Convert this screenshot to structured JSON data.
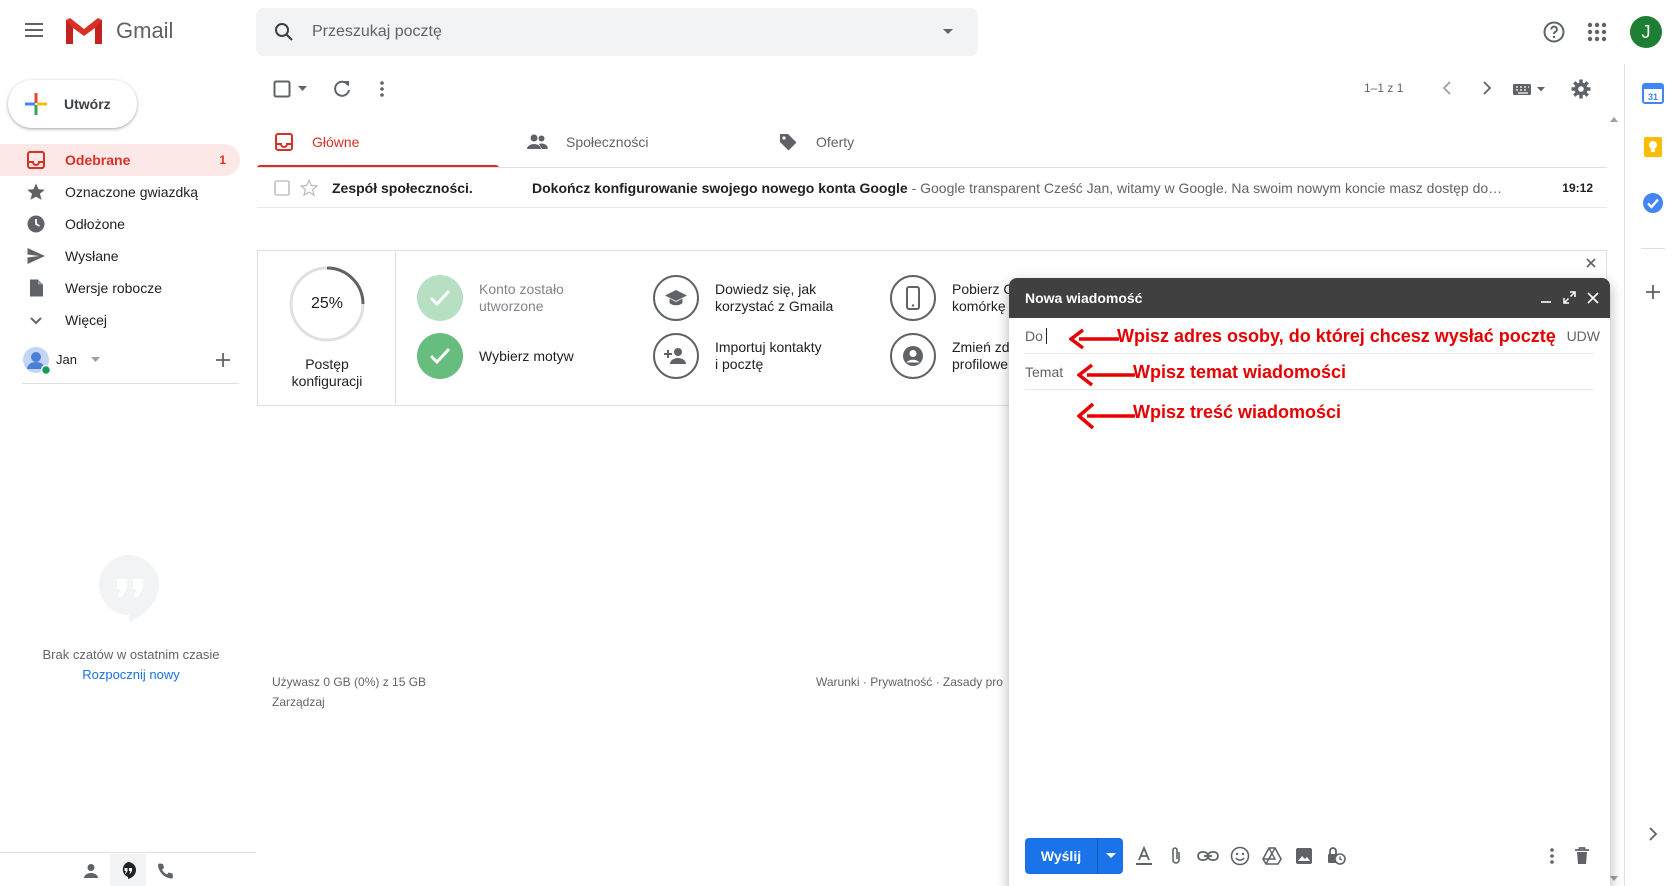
{
  "app": {
    "logo_text": "Gmail",
    "avatar_letter": "J"
  },
  "search": {
    "placeholder": "Przeszukaj pocztę"
  },
  "sidebar": {
    "compose_label": "Utwórz",
    "items": [
      {
        "label": "Odebrane",
        "count": "1"
      },
      {
        "label": "Oznaczone gwiazdką"
      },
      {
        "label": "Odłożone"
      },
      {
        "label": "Wysłane"
      },
      {
        "label": "Wersje robocze"
      },
      {
        "label": "Więcej"
      }
    ],
    "user_name": "Jan",
    "chat_empty": "Brak czatów w ostatnim czasie",
    "chat_start": "Rozpocznij nowy"
  },
  "toolbar": {
    "page_info": "1–1 z 1"
  },
  "tabs": [
    {
      "label": "Główne"
    },
    {
      "label": "Społeczności"
    },
    {
      "label": "Oferty"
    }
  ],
  "mail": {
    "sender": "Zespół społeczności.",
    "subject": "Dokończ konfigurowanie swojego nowego konta Google",
    "snippet": " - Google transparent Cześć Jan, witamy w Google. Na swoim nowym koncie masz dostęp do…",
    "time": "19:12"
  },
  "setup": {
    "progress_value": 25,
    "progress_text": "25%",
    "progress_label_1": "Postęp",
    "progress_label_2": "konfiguracji",
    "items": [
      {
        "line1": "Konto zostało",
        "line2": "utworzone"
      },
      {
        "line1": "Wybierz motyw"
      },
      {
        "line1": "Dowiedz się, jak",
        "line2": "korzystać z Gmaila"
      },
      {
        "line1": "Importuj kontakty",
        "line2": "i pocztę"
      },
      {
        "line1": "Pobierz G",
        "line2": "komórkę"
      },
      {
        "line1": "Zmień zdj",
        "line2": "profilowe"
      }
    ]
  },
  "footer": {
    "storage": "Używasz 0 GB (0%) z 15 GB",
    "manage": "Zarządzaj",
    "links": "Warunki · Prywatność · Zasady pro"
  },
  "compose": {
    "title": "Nowa wiadomość",
    "to_label": "Do",
    "bcc_label": "UDW",
    "subject_label": "Temat",
    "send_label": "Wyślij",
    "hint_to": "Wpisz adres osoby, do której chcesz wysłać pocztę",
    "hint_subject": "Wpisz temat wiadomości",
    "hint_body": "Wpisz treść wiadomości"
  },
  "colors": {
    "accent_red": "#d93025",
    "send_blue": "#1a73e8",
    "annotation_red": "#e60000"
  }
}
